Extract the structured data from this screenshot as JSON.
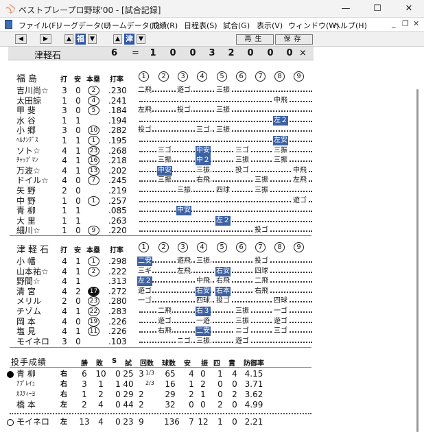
{
  "window": {
    "title": "ベストプレープロ野球'00 - [試合記録]",
    "icon": "baseball-cap-icon",
    "minimize": "—",
    "maximize": "☐",
    "close": "✕"
  },
  "menu": [
    "ファイル(F)",
    "リーグデータ(L)",
    "チームデータ(T)",
    "成績(R)",
    "日程表(S)",
    "試合(G)",
    "表示(V)",
    "ウィンドウ(W)",
    "ヘルプ(H)"
  ],
  "mdi": {
    "minimize": "_",
    "restore": "❐",
    "close": "✕"
  },
  "toolbar": {
    "left_arrow": "◀",
    "right_arrow": "▶",
    "up1": "▲",
    "team1": "福",
    "down1": "▼",
    "up2": "▲",
    "team2": "津",
    "down2": "▼",
    "replay": "再生",
    "save": "保存"
  },
  "score": {
    "team": "津軽石",
    "total": "6",
    "eq": "=",
    "innings": [
      "1",
      "0",
      "0",
      "3",
      "2",
      "0",
      "0",
      "0"
    ],
    "last": "×"
  },
  "away": {
    "team": "福島",
    "headers": [
      "打",
      "安",
      "本塁",
      "打率"
    ],
    "innings": [
      "1",
      "2",
      "3",
      "4",
      "5",
      "6",
      "7",
      "8",
      "9"
    ],
    "players": [
      {
        "name": "吉川尚☆",
        "ab": "3",
        "h": "0",
        "hr": "2",
        "hrf": false,
        "avg": ".230",
        "res": [
          {
            "i": 1,
            "t": "二飛"
          },
          {
            "i": 3,
            "t": "遊ゴ"
          },
          {
            "i": 5,
            "t": "三振"
          }
        ]
      },
      {
        "name": "太田諒",
        "ab": "1",
        "h": "0",
        "hr": "4",
        "hrf": false,
        "avg": ".241",
        "res": [
          {
            "i": 8,
            "t": "中飛"
          }
        ]
      },
      {
        "name": "甲 斐",
        "ab": "3",
        "h": "0",
        "hr": "5",
        "hrf": false,
        "avg": ".184",
        "res": [
          {
            "i": 1,
            "t": "左飛"
          },
          {
            "i": 3,
            "t": "投ゴ"
          },
          {
            "i": 5,
            "t": "三振"
          }
        ]
      },
      {
        "name": "水 谷",
        "ab": "1",
        "h": "1",
        "hr": "",
        "hrf": false,
        "avg": ".194",
        "res": [
          {
            "i": 8,
            "t": "左２",
            "hl": true
          }
        ]
      },
      {
        "name": "小 郷",
        "ab": "3",
        "h": "0",
        "hr": "10",
        "hrf": false,
        "avg": ".282",
        "res": [
          {
            "i": 1,
            "t": "投ゴ"
          },
          {
            "i": 4,
            "t": "三ゴ"
          },
          {
            "i": 5,
            "t": "三振"
          }
        ]
      },
      {
        "name": "ﾍﾙﾅﾝﾃﾞｽ",
        "small": true,
        "ab": "1",
        "h": "1",
        "hr": "1",
        "hrf": false,
        "avg": ".195",
        "res": [
          {
            "i": 8,
            "t": "左安",
            "hl": true
          }
        ]
      },
      {
        "name": "ソト☆",
        "ab": "4",
        "h": "1",
        "hr": "23",
        "hrf": false,
        "avg": ".268",
        "res": [
          {
            "i": 2,
            "t": "三ゴ"
          },
          {
            "i": 4,
            "t": "中安",
            "hl": true
          },
          {
            "i": 6,
            "t": "三ゴ"
          },
          {
            "i": 8,
            "t": "三振"
          }
        ]
      },
      {
        "name": "ﾁｬｯﾌﾟﾏﾝ",
        "small": true,
        "ab": "4",
        "h": "1",
        "hr": "16",
        "hrf": false,
        "avg": ".218",
        "res": [
          {
            "i": 2,
            "t": "三振"
          },
          {
            "i": 4,
            "t": "中２",
            "hl": true
          },
          {
            "i": 6,
            "t": "三振"
          },
          {
            "i": 8,
            "t": "三振"
          }
        ]
      },
      {
        "name": "万波☆",
        "ab": "4",
        "h": "1",
        "hr": "13",
        "hrf": false,
        "avg": ".202",
        "res": [
          {
            "i": 2,
            "t": "中安",
            "hl": true
          },
          {
            "i": 4,
            "t": "三振"
          },
          {
            "i": 6,
            "t": "投ゴ"
          },
          {
            "i": 9,
            "t": "中飛"
          }
        ]
      },
      {
        "name": "ドイル☆",
        "ab": "4",
        "h": "0",
        "hr": "7",
        "hrf": false,
        "avg": ".245",
        "res": [
          {
            "i": 2,
            "t": "三振"
          },
          {
            "i": 4,
            "t": "右飛"
          },
          {
            "i": 7,
            "t": "三振"
          },
          {
            "i": 9,
            "t": "左飛"
          }
        ]
      },
      {
        "name": "矢 野",
        "ab": "2",
        "h": "0",
        "hr": "",
        "hrf": false,
        "avg": ".219",
        "res": [
          {
            "i": 3,
            "t": "三振"
          },
          {
            "i": 5,
            "t": "四球"
          },
          {
            "i": 7,
            "t": "三振"
          }
        ]
      },
      {
        "name": "中 野",
        "ab": "1",
        "h": "0",
        "hr": "1",
        "hrf": false,
        "avg": ".257",
        "res": [
          {
            "i": 9,
            "t": "遊ゴ"
          }
        ]
      },
      {
        "name": "青 柳",
        "ab": "1",
        "h": "1",
        "hr": "",
        "hrf": false,
        "avg": ".085",
        "res": [
          {
            "i": 3,
            "t": "中安",
            "hl": true
          }
        ]
      },
      {
        "name": "大 里",
        "ab": "1",
        "h": "1",
        "hr": "",
        "hrf": false,
        "avg": ".263",
        "res": [
          {
            "i": 5,
            "t": "左２",
            "hl": true
          }
        ]
      },
      {
        "name": "細川☆",
        "ab": "1",
        "h": "0",
        "hr": "9",
        "hrf": false,
        "avg": ".220",
        "res": [
          {
            "i": 7,
            "t": "投ゴ"
          }
        ]
      }
    ]
  },
  "home": {
    "team": "津軽石",
    "headers": [
      "打",
      "安",
      "本塁",
      "打率"
    ],
    "innings": [
      "1",
      "2",
      "3",
      "4",
      "5",
      "6",
      "7",
      "8",
      "9"
    ],
    "players": [
      {
        "name": "小 幡",
        "ab": "4",
        "h": "1",
        "hr": "1",
        "hrf": false,
        "avg": ".298",
        "res": [
          {
            "i": 1,
            "t": "二安",
            "hl": true
          },
          {
            "i": 3,
            "t": "遊飛"
          },
          {
            "i": 4,
            "t": "三振"
          },
          {
            "i": 7,
            "t": "投ゴ"
          }
        ]
      },
      {
        "name": "山本祐☆",
        "ab": "4",
        "h": "1",
        "hr": "2",
        "hrf": false,
        "avg": ".222",
        "res": [
          {
            "i": 1,
            "t": "三ギ"
          },
          {
            "i": 3,
            "t": "左飛"
          },
          {
            "i": 5,
            "t": "右安",
            "hl": true
          },
          {
            "i": 7,
            "t": "四球"
          }
        ]
      },
      {
        "name": "野間☆",
        "ab": "4",
        "h": "1",
        "hr": "",
        "hrf": false,
        "avg": ".313",
        "res": [
          {
            "i": 1,
            "t": "左２",
            "hl": true
          },
          {
            "i": 4,
            "t": "中飛"
          },
          {
            "i": 5,
            "t": "右飛"
          },
          {
            "i": 7,
            "t": "二飛"
          }
        ]
      },
      {
        "name": "清 宮",
        "ab": "4",
        "h": "2",
        "hr": "17",
        "hrf": true,
        "avg": ".272",
        "res": [
          {
            "i": 1,
            "t": "遊ゴ"
          },
          {
            "i": 4,
            "t": "右安",
            "hl": true
          },
          {
            "i": 5,
            "t": "右本",
            "hl": true
          },
          {
            "i": 7,
            "t": "右飛"
          }
        ]
      },
      {
        "name": "メリル",
        "ab": "2",
        "h": "0",
        "hr": "23",
        "hrf": false,
        "avg": ".280",
        "res": [
          {
            "i": 1,
            "t": "一ゴ"
          },
          {
            "i": 4,
            "t": "四球"
          },
          {
            "i": 5,
            "t": "投ゴ"
          },
          {
            "i": 8,
            "t": "四球"
          }
        ]
      },
      {
        "name": "チゾム",
        "ab": "4",
        "h": "1",
        "hr": "22",
        "hrf": false,
        "avg": ".283",
        "res": [
          {
            "i": 2,
            "t": "二飛"
          },
          {
            "i": 4,
            "t": "右３",
            "hl": true
          },
          {
            "i": 6,
            "t": "三振"
          },
          {
            "i": 8,
            "t": "一ゴ"
          }
        ]
      },
      {
        "name": "岡 本",
        "ab": "4",
        "h": "0",
        "hr": "19",
        "hrf": false,
        "avg": ".226",
        "res": [
          {
            "i": 2,
            "t": "遊ゴ"
          },
          {
            "i": 4,
            "t": "一遊"
          },
          {
            "i": 6,
            "t": "三振"
          },
          {
            "i": 8,
            "t": "遊ゴ"
          }
        ]
      },
      {
        "name": "塩 見",
        "ab": "4",
        "h": "1",
        "hr": "11",
        "hrf": false,
        "avg": ".226",
        "res": [
          {
            "i": 2,
            "t": "右飛"
          },
          {
            "i": 4,
            "t": "二安",
            "hl": true
          },
          {
            "i": 6,
            "t": "ニゴ"
          },
          {
            "i": 8,
            "t": "三ゴ"
          }
        ]
      },
      {
        "name": "モイネロ",
        "ab": "3",
        "h": "0",
        "hr": "",
        "hrf": false,
        "avg": ".103",
        "res": [
          {
            "i": 3,
            "t": "ニゴ"
          },
          {
            "i": 4,
            "t": "三振"
          },
          {
            "i": 6,
            "t": "遊ゴ"
          }
        ]
      }
    ]
  },
  "pitching": {
    "title": "投手成績",
    "headers": [
      "勝",
      "敗",
      "S",
      "試",
      "回数",
      "球数",
      "安",
      "振",
      "四",
      "責",
      "防御率"
    ],
    "away": [
      {
        "name": "青 柳",
        "bullet": "filled",
        "hand": "右",
        "w": "6",
        "l": "10",
        "s": "0",
        "g": "25",
        "ip": "3",
        "ipf": "1/3",
        "pc": "65",
        "h": "4",
        "k": "0",
        "bb": "1",
        "er": "4",
        "era": "4.15"
      },
      {
        "name": "ｱﾌﾟﾚｲｭ",
        "small": true,
        "hand": "右",
        "w": "3",
        "l": "1",
        "s": "1",
        "g": "40",
        "ip": "",
        "ipf": "2/3",
        "pc": "16",
        "h": "1",
        "k": "2",
        "bb": "0",
        "er": "0",
        "era": "3.71"
      },
      {
        "name": "ｶｽﾃｨｰﾖ",
        "small": true,
        "hand": "右",
        "w": "1",
        "l": "2",
        "s": "0",
        "g": "29",
        "ip": "2",
        "ipf": "",
        "pc": "29",
        "h": "2",
        "k": "1",
        "bb": "0",
        "er": "2",
        "era": "3.62"
      },
      {
        "name": "橋 本",
        "hand": "左",
        "w": "2",
        "l": "4",
        "s": "0",
        "g": "44",
        "ip": "2",
        "ipf": "",
        "pc": "32",
        "h": "0",
        "k": "0",
        "bb": "2",
        "er": "0",
        "era": "4.99"
      }
    ],
    "home": [
      {
        "name": "モイネロ",
        "bullet": "open",
        "hand": "左",
        "w": "13",
        "l": "4",
        "s": "0",
        "g": "23",
        "ip": "9",
        "ipf": "",
        "pc": "136",
        "h": "7",
        "k": "12",
        "bb": "1",
        "er": "0",
        "era": "2.21"
      }
    ]
  }
}
